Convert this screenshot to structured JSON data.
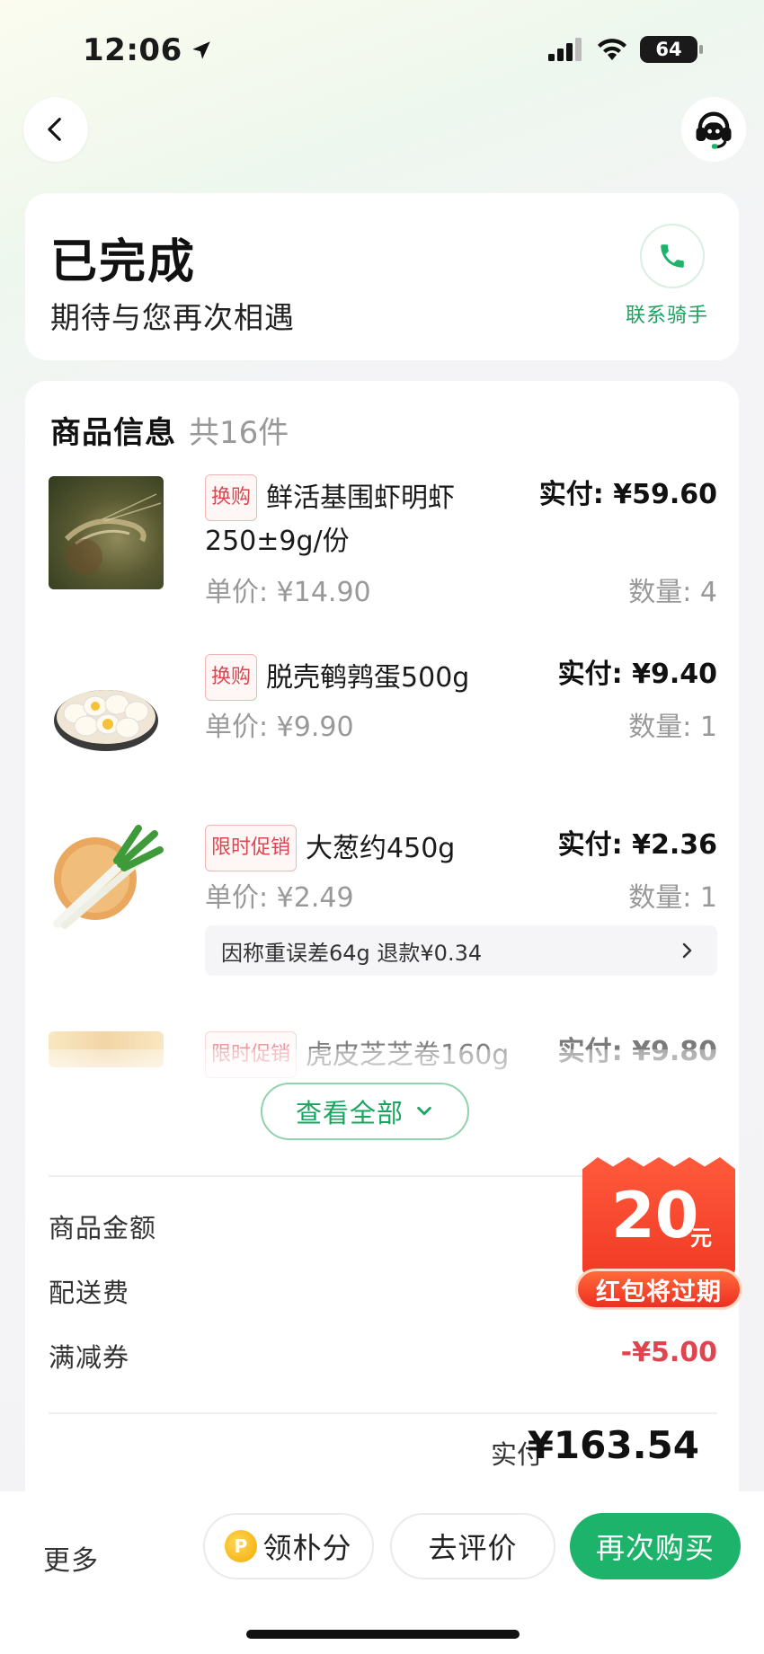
{
  "status_bar": {
    "time": "12:06",
    "battery": "64"
  },
  "order": {
    "status_title": "已完成",
    "status_subtitle": "期待与您再次相遇",
    "contact_rider_label": "联系骑手"
  },
  "goods": {
    "title": "商品信息",
    "count_label": "共16件",
    "items": [
      {
        "tag": "换购",
        "name": "鲜活基围虾明虾250±9g/份",
        "paid": "实付: ¥59.60",
        "unit_price": "单价: ¥14.90",
        "qty": "数量: 4"
      },
      {
        "tag": "换购",
        "name": "脱壳鹌鹑蛋500g",
        "paid": "实付: ¥9.40",
        "unit_price": "单价: ¥9.90",
        "qty": "数量: 1"
      },
      {
        "tag": "限时促销",
        "name": "大葱约450g",
        "paid": "实付: ¥2.36",
        "unit_price": "单价: ¥2.49",
        "qty": "数量: 1",
        "refund_note": "因称重误差64g 退款¥0.34"
      },
      {
        "tag": "限时促销",
        "name": "虎皮芝芝卷160g",
        "paid": "实付: ¥9.80"
      }
    ],
    "view_all_label": "查看全部"
  },
  "fees": {
    "goods_amount_label": "商品金额",
    "delivery_label": "配送费",
    "discount_label": "满减券",
    "discount_value": "-¥5.00"
  },
  "total": {
    "label": "实付",
    "value": "¥163.54"
  },
  "coupon": {
    "amount": "20",
    "unit": "元",
    "label": "红包将过期"
  },
  "bottom_bar": {
    "more_label": "更多",
    "points_label": "领朴分",
    "points_coin": "P",
    "review_label": "去评价",
    "rebuy_label": "再次购买"
  },
  "colors": {
    "brand_green": "#1db36a",
    "accent_red": "#e0454f"
  }
}
